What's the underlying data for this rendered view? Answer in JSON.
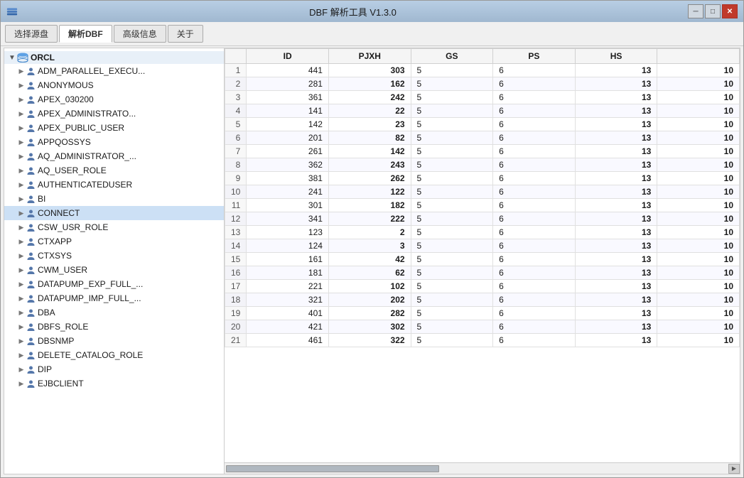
{
  "window": {
    "title": "DBF 解析工具 V1.3.0"
  },
  "toolbar": {
    "tabs": [
      {
        "id": "select-source",
        "label": "选择源盘",
        "active": false
      },
      {
        "id": "parse-dbf",
        "label": "解析DBF",
        "active": true
      },
      {
        "id": "advanced-info",
        "label": "高级信息",
        "active": false
      },
      {
        "id": "about",
        "label": "关于",
        "active": false
      }
    ]
  },
  "tree": {
    "root": {
      "label": "ORCL",
      "expanded": true
    },
    "items": [
      {
        "label": "ADM_PARALLEL_EXECU...",
        "hasChildren": true
      },
      {
        "label": "ANONYMOUS",
        "hasChildren": true
      },
      {
        "label": "APEX_030200",
        "hasChildren": true
      },
      {
        "label": "APEX_ADMINISTRATO...",
        "hasChildren": true
      },
      {
        "label": "APEX_PUBLIC_USER",
        "hasChildren": true
      },
      {
        "label": "APPQOSSYS",
        "hasChildren": true
      },
      {
        "label": "AQ_ADMINISTRATOR_...",
        "hasChildren": true
      },
      {
        "label": "AQ_USER_ROLE",
        "hasChildren": true
      },
      {
        "label": "AUTHENTICATEDUSER",
        "hasChildren": true
      },
      {
        "label": "BI",
        "hasChildren": true
      },
      {
        "label": "CONNECT",
        "hasChildren": true
      },
      {
        "label": "CSW_USR_ROLE",
        "hasChildren": true
      },
      {
        "label": "CTXAPP",
        "hasChildren": true
      },
      {
        "label": "CTXSYS",
        "hasChildren": true
      },
      {
        "label": "CWM_USER",
        "hasChildren": true
      },
      {
        "label": "DATAPUMP_EXP_FULL_...",
        "hasChildren": true
      },
      {
        "label": "DATAPUMP_IMP_FULL_...",
        "hasChildren": true
      },
      {
        "label": "DBA",
        "hasChildren": true
      },
      {
        "label": "DBFS_ROLE",
        "hasChildren": true
      },
      {
        "label": "DBSNMP",
        "hasChildren": true
      },
      {
        "label": "DELETE_CATALOG_ROLE",
        "hasChildren": true
      },
      {
        "label": "DIP",
        "hasChildren": true
      },
      {
        "label": "EJBCLIENT",
        "hasChildren": true
      }
    ]
  },
  "table": {
    "columns": [
      {
        "id": "row-num",
        "label": ""
      },
      {
        "id": "id",
        "label": "ID"
      },
      {
        "id": "pjxh",
        "label": "PJXH"
      },
      {
        "id": "gs",
        "label": "GS"
      },
      {
        "id": "ps",
        "label": "PS"
      },
      {
        "id": "hs",
        "label": "HS"
      }
    ],
    "rows": [
      {
        "rowNum": 1,
        "id": 441,
        "pjxh": 303,
        "gs": 5,
        "ps": 6,
        "hs": 13,
        "extra": 10
      },
      {
        "rowNum": 2,
        "id": 281,
        "pjxh": 162,
        "gs": 5,
        "ps": 6,
        "hs": 13,
        "extra": 10
      },
      {
        "rowNum": 3,
        "id": 361,
        "pjxh": 242,
        "gs": 5,
        "ps": 6,
        "hs": 13,
        "extra": 10
      },
      {
        "rowNum": 4,
        "id": 141,
        "pjxh": 22,
        "gs": 5,
        "ps": 6,
        "hs": 13,
        "extra": 10
      },
      {
        "rowNum": 5,
        "id": 142,
        "pjxh": 23,
        "gs": 5,
        "ps": 6,
        "hs": 13,
        "extra": 10
      },
      {
        "rowNum": 6,
        "id": 201,
        "pjxh": 82,
        "gs": 5,
        "ps": 6,
        "hs": 13,
        "extra": 10
      },
      {
        "rowNum": 7,
        "id": 261,
        "pjxh": 142,
        "gs": 5,
        "ps": 6,
        "hs": 13,
        "extra": 10
      },
      {
        "rowNum": 8,
        "id": 362,
        "pjxh": 243,
        "gs": 5,
        "ps": 6,
        "hs": 13,
        "extra": 10
      },
      {
        "rowNum": 9,
        "id": 381,
        "pjxh": 262,
        "gs": 5,
        "ps": 6,
        "hs": 13,
        "extra": 10
      },
      {
        "rowNum": 10,
        "id": 241,
        "pjxh": 122,
        "gs": 5,
        "ps": 6,
        "hs": 13,
        "extra": 10
      },
      {
        "rowNum": 11,
        "id": 301,
        "pjxh": 182,
        "gs": 5,
        "ps": 6,
        "hs": 13,
        "extra": 10
      },
      {
        "rowNum": 12,
        "id": 341,
        "pjxh": 222,
        "gs": 5,
        "ps": 6,
        "hs": 13,
        "extra": 10
      },
      {
        "rowNum": 13,
        "id": 123,
        "pjxh": 2,
        "gs": 5,
        "ps": 6,
        "hs": 13,
        "extra": 10
      },
      {
        "rowNum": 14,
        "id": 124,
        "pjxh": 3,
        "gs": 5,
        "ps": 6,
        "hs": 13,
        "extra": 10
      },
      {
        "rowNum": 15,
        "id": 161,
        "pjxh": 42,
        "gs": 5,
        "ps": 6,
        "hs": 13,
        "extra": 10
      },
      {
        "rowNum": 16,
        "id": 181,
        "pjxh": 62,
        "gs": 5,
        "ps": 6,
        "hs": 13,
        "extra": 10
      },
      {
        "rowNum": 17,
        "id": 221,
        "pjxh": 102,
        "gs": 5,
        "ps": 6,
        "hs": 13,
        "extra": 10
      },
      {
        "rowNum": 18,
        "id": 321,
        "pjxh": 202,
        "gs": 5,
        "ps": 6,
        "hs": 13,
        "extra": 10
      },
      {
        "rowNum": 19,
        "id": 401,
        "pjxh": 282,
        "gs": 5,
        "ps": 6,
        "hs": 13,
        "extra": 10
      },
      {
        "rowNum": 20,
        "id": 421,
        "pjxh": 302,
        "gs": 5,
        "ps": 6,
        "hs": 13,
        "extra": 10
      },
      {
        "rowNum": 21,
        "id": 461,
        "pjxh": 322,
        "gs": 5,
        "ps": 6,
        "hs": 13,
        "extra": 10
      }
    ]
  },
  "controls": {
    "minimize": "─",
    "maximize": "□",
    "close": "✕"
  }
}
